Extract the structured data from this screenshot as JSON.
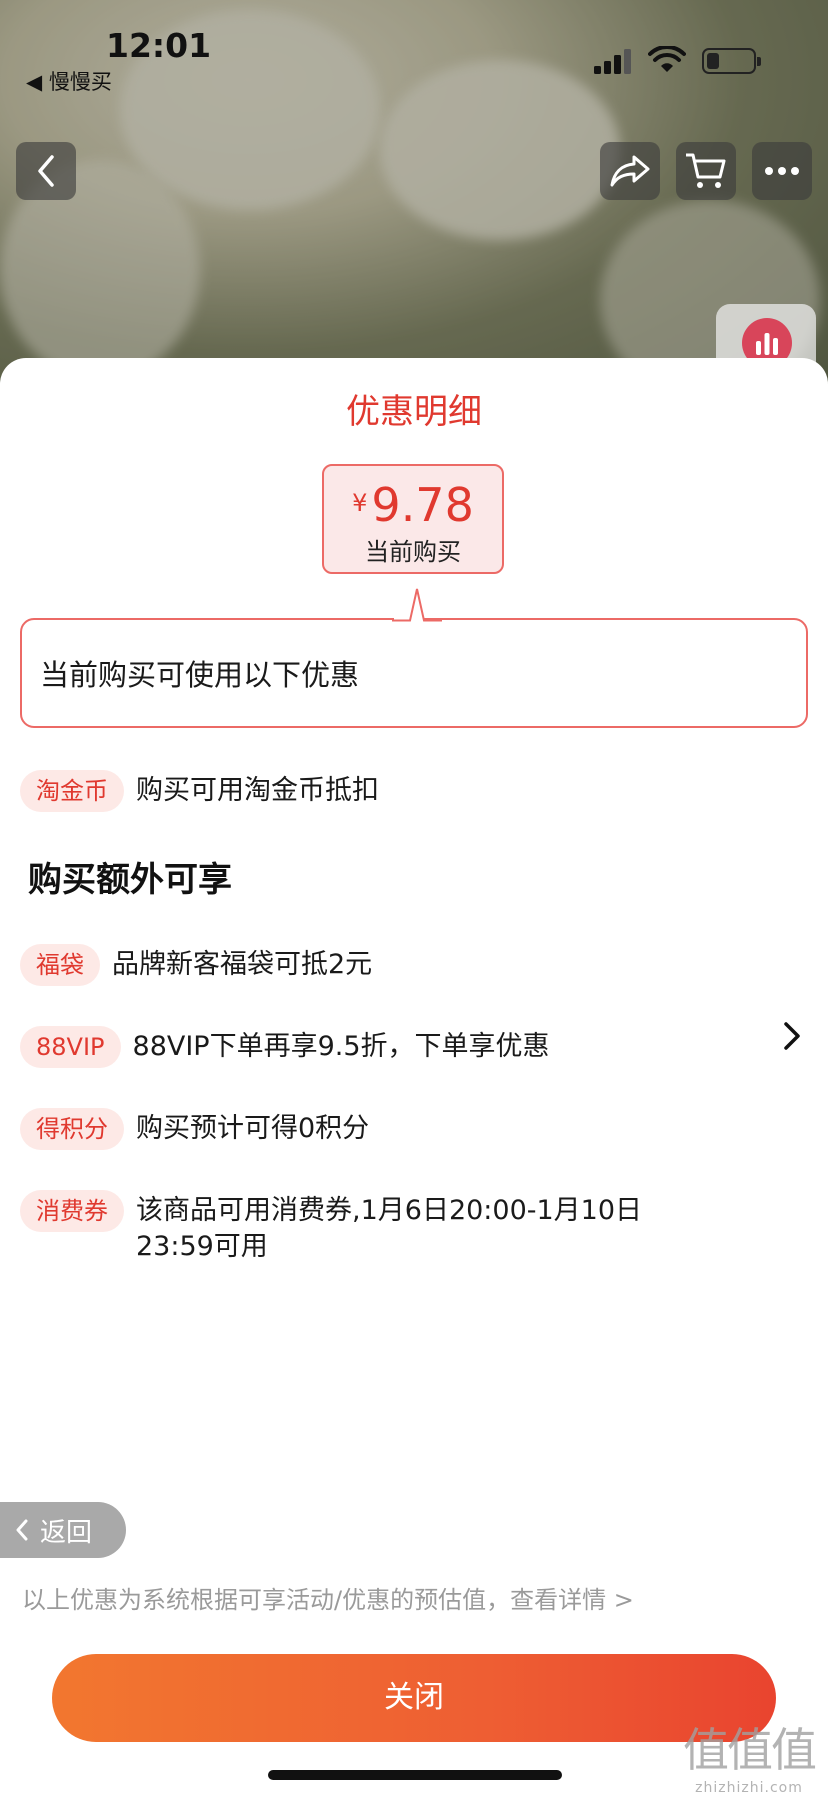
{
  "status_bar": {
    "time": "12:01",
    "back_app": "◀ 慢慢买"
  },
  "sheet": {
    "title": "优惠明细",
    "price": {
      "currency": "¥",
      "value": "9.78",
      "label": "当前购买"
    },
    "bubble_text": "当前购买可使用以下优惠",
    "primary_offer": {
      "tag": "淘金币",
      "text": "购买可用淘金币抵扣"
    },
    "section_title": "购买额外可享",
    "extras": [
      {
        "tag": "福袋",
        "text": "品牌新客福袋可抵2元"
      },
      {
        "tag": "88VIP",
        "text": "88VIP下单再享9.5折，下单享优惠"
      },
      {
        "tag": "得积分",
        "text": "购买预计可得0积分"
      },
      {
        "tag": "消费券",
        "text": "该商品可用消费券,1月6日20:00-1月10日\n23:59可用"
      }
    ],
    "back_label": "返回",
    "disclaimer": "以上优惠为系统根据可享活动/优惠的预估值，查看详情 >",
    "close_label": "关闭"
  },
  "watermark": {
    "big": "值值值",
    "small": "zhizhizhi.com"
  },
  "colors": {
    "accent": "#e0392f",
    "tag_bg": "#fde9e6",
    "button_gradient_start": "#f2772f",
    "button_gradient_end": "#e9442f"
  },
  "icons": [
    "back-arrow-icon",
    "share-icon",
    "cart-icon",
    "more-icon",
    "stats-icon",
    "chevron-right-icon",
    "chevron-left-icon"
  ]
}
